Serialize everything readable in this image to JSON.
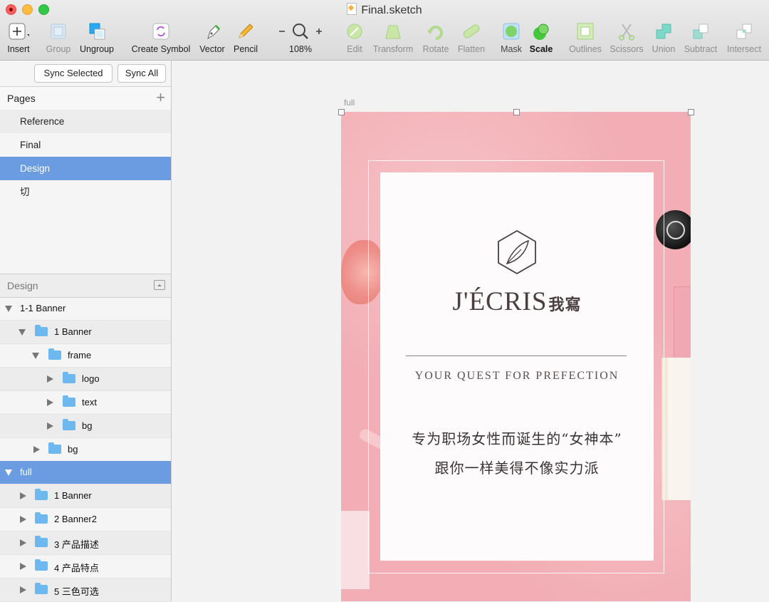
{
  "window": {
    "title": "Final.sketch"
  },
  "toolbar": {
    "items": [
      {
        "label": "Insert",
        "icon": "plus-icon"
      },
      {
        "label": "Group",
        "icon": "group-icon"
      },
      {
        "label": "Ungroup",
        "icon": "ungroup-icon"
      },
      {
        "label": "Create Symbol",
        "icon": "symbol-icon"
      },
      {
        "label": "Vector",
        "icon": "pen-icon"
      },
      {
        "label": "Pencil",
        "icon": "pencil-icon"
      },
      {
        "label": "108%",
        "icon": "zoom-icon"
      },
      {
        "label": "Edit",
        "icon": "edit-icon"
      },
      {
        "label": "Transform",
        "icon": "transform-icon"
      },
      {
        "label": "Rotate",
        "icon": "rotate-icon"
      },
      {
        "label": "Flatten",
        "icon": "flatten-icon"
      },
      {
        "label": "Mask",
        "icon": "mask-icon"
      },
      {
        "label": "Scale",
        "icon": "scale-icon"
      },
      {
        "label": "Outlines",
        "icon": "outlines-icon"
      },
      {
        "label": "Scissors",
        "icon": "scissors-icon"
      },
      {
        "label": "Union",
        "icon": "union-icon"
      },
      {
        "label": "Subtract",
        "icon": "subtract-icon"
      },
      {
        "label": "Intersect",
        "icon": "intersect-icon"
      }
    ]
  },
  "sidebar": {
    "sync_selected": "Sync Selected",
    "sync_all": "Sync All",
    "pages_label": "Pages",
    "add_symbol": "+",
    "pages": [
      "Reference",
      "Final",
      "Design",
      "切"
    ],
    "selected_page": "Design",
    "layers_label": "Design",
    "layers": [
      {
        "name": "1-1 Banner"
      },
      {
        "name": "1 Banner"
      },
      {
        "name": "frame"
      },
      {
        "name": "logo"
      },
      {
        "name": "text"
      },
      {
        "name": "bg"
      },
      {
        "name": "bg"
      },
      {
        "name": "full"
      },
      {
        "name": "1 Banner"
      },
      {
        "name": "2 Banner2"
      },
      {
        "name": "3 产品描述"
      },
      {
        "name": "4 产品特点"
      },
      {
        "name": "5 三色可选"
      }
    ]
  },
  "canvas": {
    "artboard_label": "full",
    "brand_title": "J'ÉCRIS",
    "brand_cn": "我寫",
    "tagline": "YOUR QUEST FOR PREFECTION",
    "cn_line1": "专为职场女性而诞生的“女神本”",
    "cn_line2": "跟你一样美得不像实力派"
  },
  "colors": {
    "selection_blue": "#6b9be0",
    "folder_blue": "#6cb8ef",
    "artboard_pink": "#f2aeb4"
  }
}
